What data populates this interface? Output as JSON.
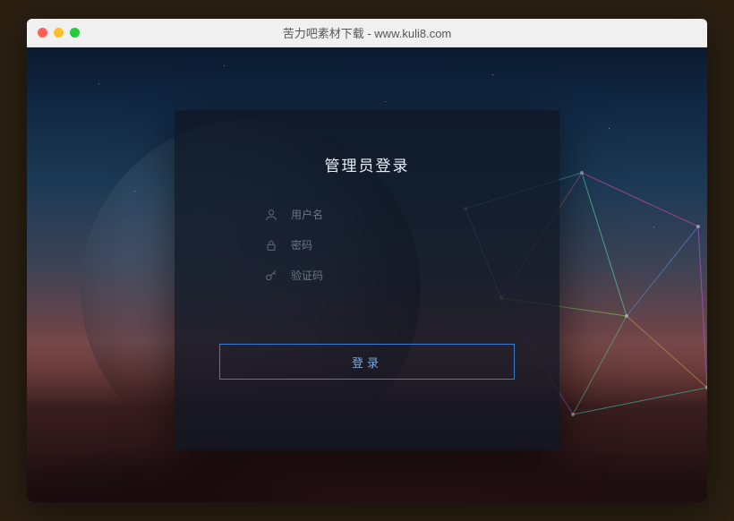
{
  "window": {
    "title": "苦力吧素材下载 - www.kuli8.com"
  },
  "login": {
    "title": "管理员登录",
    "username_placeholder": "用户名",
    "password_placeholder": "密码",
    "captcha_placeholder": "验证码",
    "submit_label": "登录"
  },
  "colors": {
    "accent": "#3b7bd1"
  }
}
